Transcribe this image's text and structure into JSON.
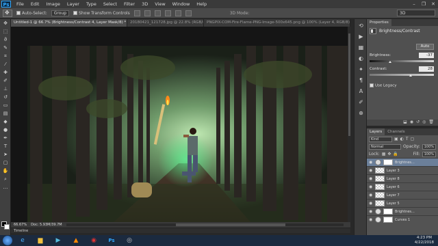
{
  "app": {
    "logo": "Ps"
  },
  "menu": [
    "File",
    "Edit",
    "Image",
    "Layer",
    "Type",
    "Select",
    "Filter",
    "3D",
    "View",
    "Window",
    "Help"
  ],
  "window_controls": [
    "–",
    "❐",
    "✕"
  ],
  "options": {
    "auto_select_label": "Auto-Select:",
    "auto_select_value": "Group",
    "transform_label": "Show Transform Controls",
    "mode_label": "3D Mode:",
    "workspace": "3D"
  },
  "tabs": [
    "Untitled-1 @ 66.7% (Brightness/Contrast 4, Layer Mask/8) *",
    "20180421_121728.jpg @ 22.8% (RGB/8)",
    "PNGPIX-COM-Fire-Flame-PNG-Image-500x645.png @ 100% (Layer 4, RGB/8)"
  ],
  "status": {
    "zoom": "66.67%",
    "doc": "Doc: 5.93M/39.7M"
  },
  "timeline_label": "Timeline",
  "properties": {
    "tabs": [
      "Properties"
    ],
    "title": "Brightness/Contrast",
    "auto_label": "Auto",
    "brightness_label": "Brightness:",
    "brightness_value": "-37",
    "brightness_level": -37,
    "contrast_label": "Contrast:",
    "contrast_value": "28",
    "contrast_level": 28,
    "legacy_label": "Use Legacy"
  },
  "layers_panel": {
    "tabs": [
      "Layers",
      "Channels"
    ],
    "kind": "Kind",
    "blend_mode": "Normal",
    "opacity_label": "Opacity:",
    "opacity_value": "100%",
    "lock_label": "Lock:",
    "fill_label": "Fill:",
    "fill_value": "100%",
    "layers": [
      {
        "name": "Brightnes...",
        "type": "adjustment",
        "active": true
      },
      {
        "name": "Layer 3",
        "type": "pixel",
        "active": false
      },
      {
        "name": "Layer 8",
        "type": "pixel",
        "active": false
      },
      {
        "name": "Layer 6",
        "type": "pixel",
        "active": false
      },
      {
        "name": "Layer 7",
        "type": "pixel",
        "active": false
      },
      {
        "name": "Layer 5",
        "type": "pixel",
        "active": false
      },
      {
        "name": "Brightnes...",
        "type": "adjustment",
        "active": false
      },
      {
        "name": "Curves 1",
        "type": "adjustment",
        "active": false
      }
    ]
  },
  "clock": {
    "time": "4:23 PM",
    "date": "4/22/2018"
  },
  "colors": {
    "ps_blue": "#31a8ff",
    "selected_layer": "#6b7f99",
    "taskbar": "#1b2a3f"
  }
}
